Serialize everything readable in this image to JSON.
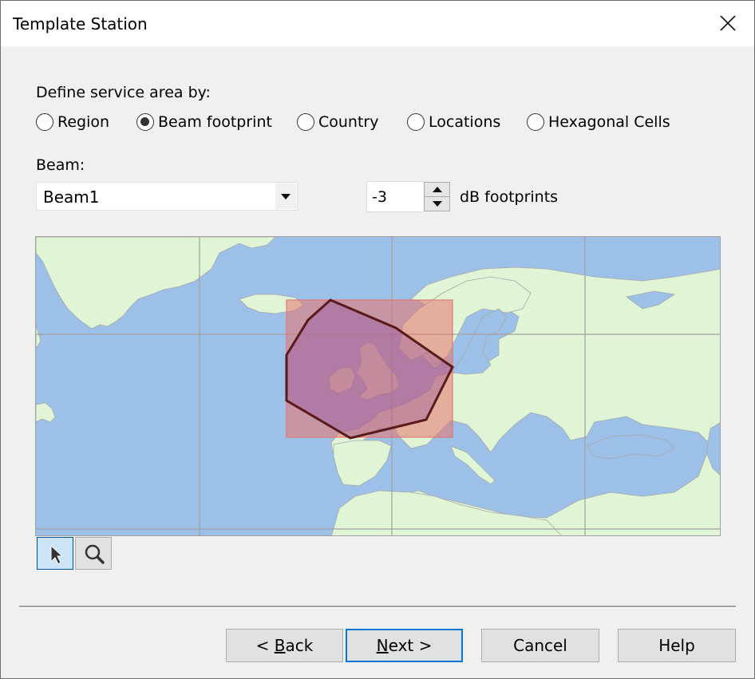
{
  "window": {
    "title": "Template Station",
    "close_icon": "close-icon"
  },
  "service_area": {
    "label": "Define service area by:",
    "options": [
      {
        "label": "Region",
        "selected": false
      },
      {
        "label": "Beam footprint",
        "selected": true
      },
      {
        "label": "Country",
        "selected": false
      },
      {
        "label": "Locations",
        "selected": false
      },
      {
        "label": "Hexagonal Cells",
        "selected": false
      }
    ]
  },
  "beam": {
    "label": "Beam:",
    "selected": "Beam1"
  },
  "footprint": {
    "value": "-3",
    "unit_label": "dB footprints"
  },
  "map": {
    "colors": {
      "water": "#9dc0e8",
      "land": "#dff5d6",
      "border": "#a8a8a8",
      "grid": "#a0a0a0",
      "footprint_fill": "#e8736e",
      "footprint_outline": "#5a1a1a"
    },
    "tools": [
      {
        "name": "pointer-tool",
        "icon": "cursor-arrow-icon",
        "active": true
      },
      {
        "name": "zoom-tool",
        "icon": "magnifier-icon",
        "active": false
      }
    ]
  },
  "buttons": {
    "back_prefix": "< ",
    "back_mnemonic": "B",
    "back_rest": "ack",
    "next_mnemonic": "N",
    "next_rest": "ext >",
    "cancel": "Cancel",
    "help": "Help"
  }
}
